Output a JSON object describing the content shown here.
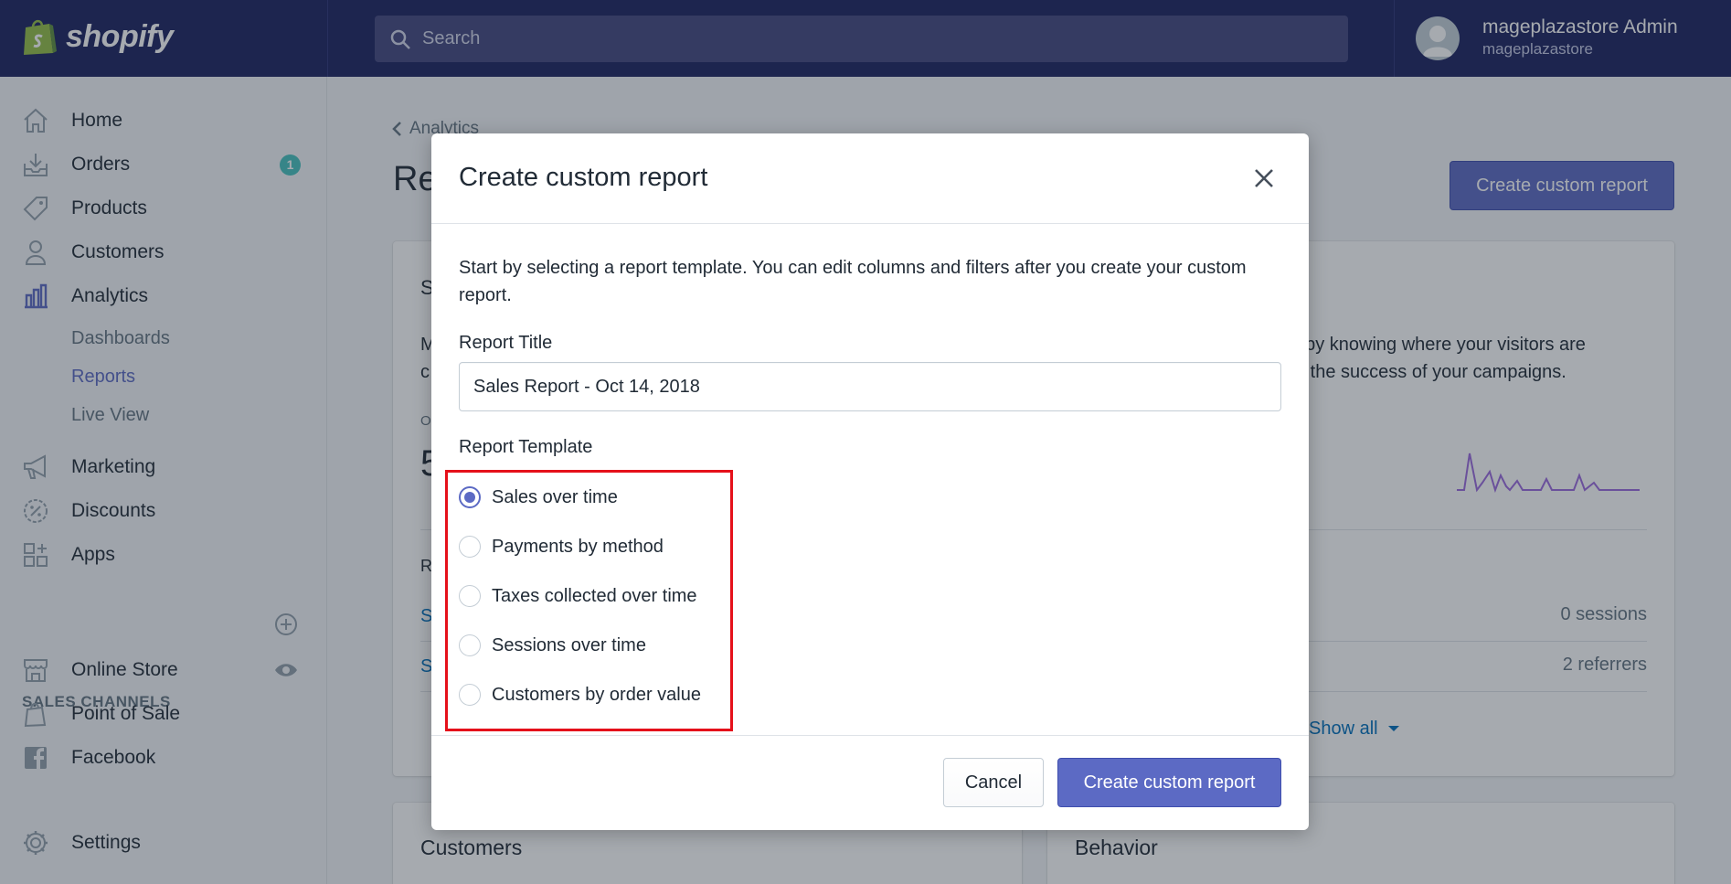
{
  "brand": {
    "name": "shopify"
  },
  "search": {
    "placeholder": "Search"
  },
  "user": {
    "name": "mageplazastore Admin",
    "store": "mageplazastore"
  },
  "sidebar": {
    "items": [
      {
        "label": "Home",
        "icon": "home-icon"
      },
      {
        "label": "Orders",
        "icon": "orders-icon",
        "badge": "1"
      },
      {
        "label": "Products",
        "icon": "tag-icon"
      },
      {
        "label": "Customers",
        "icon": "person-icon"
      },
      {
        "label": "Analytics",
        "icon": "bar-chart-icon"
      },
      {
        "label": "Marketing",
        "icon": "megaphone-icon"
      },
      {
        "label": "Discounts",
        "icon": "discount-icon"
      },
      {
        "label": "Apps",
        "icon": "apps-icon"
      }
    ],
    "analytics_sub": [
      "Dashboards",
      "Reports",
      "Live View"
    ],
    "sales_channels_title": "SALES CHANNELS",
    "channels": [
      {
        "label": "Online Store",
        "icon": "store-icon"
      },
      {
        "label": "Point of Sale",
        "icon": "pos-icon"
      },
      {
        "label": "Facebook",
        "icon": "facebook-icon"
      }
    ],
    "settings": "Settings"
  },
  "main": {
    "back_label": "Analytics",
    "page_title": "Re",
    "top_button": "Create custom report",
    "card1": {
      "heading": "S",
      "desc_prefix": "M",
      "desc_prefix2": "c",
      "desc_right1": "t by knowing where your visitors are",
      "desc_right2": "g the success of your campaigns.",
      "small_label": "O",
      "big_value": "5",
      "rows_label": "R",
      "row1_link": "S",
      "row1_value": "0 sessions",
      "row2_link": "S",
      "row2_value": "2 referrers",
      "show_all": "Show all"
    },
    "card2_title": "Customers",
    "card3_title": "Behavior"
  },
  "modal": {
    "title": "Create custom report",
    "intro": "Start by selecting a report template. You can edit columns and filters after you create your custom report.",
    "title_label": "Report Title",
    "title_value": "Sales Report - Oct 14, 2018",
    "template_label": "Report Template",
    "templates": [
      {
        "label": "Sales over time",
        "checked": true
      },
      {
        "label": "Payments by method",
        "checked": false
      },
      {
        "label": "Taxes collected over time",
        "checked": false
      },
      {
        "label": "Sessions over time",
        "checked": false
      },
      {
        "label": "Customers by order value",
        "checked": false
      }
    ],
    "cancel": "Cancel",
    "create": "Create custom report"
  },
  "colors": {
    "accent": "#5c6ac4",
    "topbar": "#1c2260",
    "highlight": "#e5101a",
    "badge": "#47c1bf"
  }
}
